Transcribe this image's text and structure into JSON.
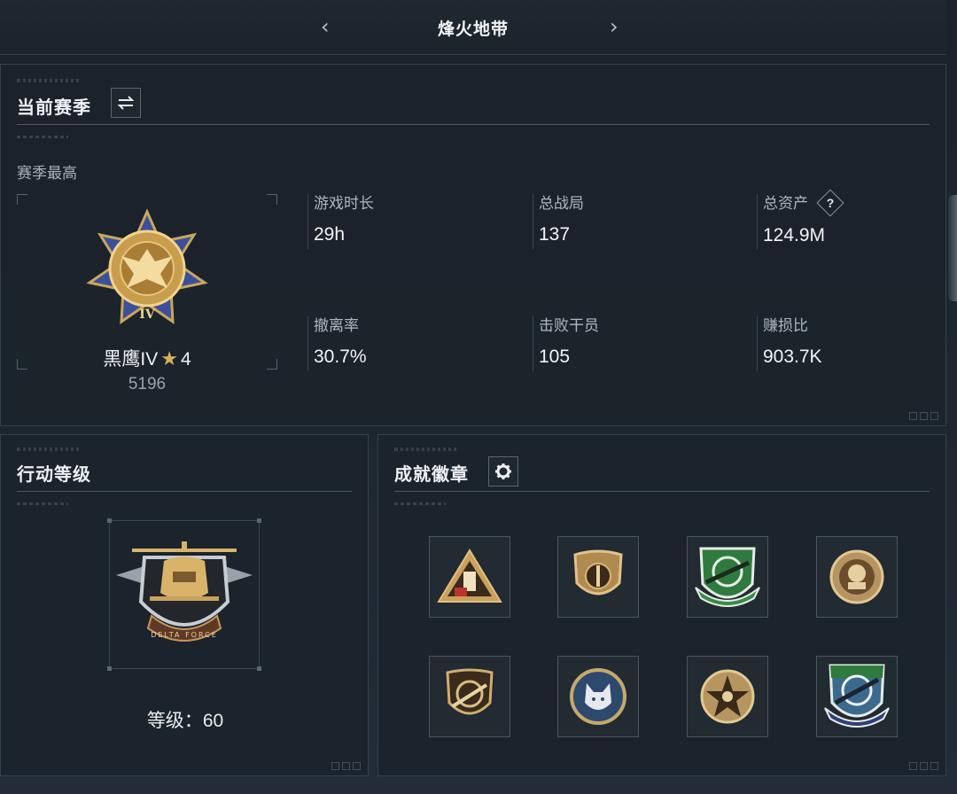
{
  "topnav": {
    "title": "烽火地带",
    "prev_icon": "chevron-left-icon",
    "next_icon": "chevron-right-icon"
  },
  "season": {
    "heading": "当前赛季",
    "switch_icon": "swap-icon",
    "sub_label": "赛季最高",
    "rank": {
      "name": "黑鹰IV",
      "stars": "4",
      "score": "5196"
    },
    "stats": [
      {
        "label": "游戏时长",
        "value": "29h"
      },
      {
        "label": "总战局",
        "value": "137"
      },
      {
        "label": "总资产",
        "value": "124.9M"
      },
      {
        "label": "撤离率",
        "value": "30.7%"
      },
      {
        "label": "击败干员",
        "value": "105"
      },
      {
        "label": "赚损比",
        "value": "903.7K"
      }
    ],
    "help_icon_text": "?"
  },
  "action": {
    "heading": "行动等级",
    "level_label": "等级：",
    "level_value": "60",
    "badge_text": "DELTA FORCE"
  },
  "achievements": {
    "heading": "成就徽章",
    "settings_icon": "gear-icon",
    "badges": [
      "triangle-badge-icon",
      "shield-badge-icon",
      "green-rifle-badge-icon",
      "skull-badge-icon",
      "rifle-shield-badge-icon",
      "wolf-badge-icon",
      "star-badge-icon",
      "blue-rifle-badge-icon"
    ]
  },
  "colors": {
    "accent_gold": "#d4b05c",
    "rank_blue": "#3b4f9a",
    "green_badge": "#2f7a3e"
  }
}
